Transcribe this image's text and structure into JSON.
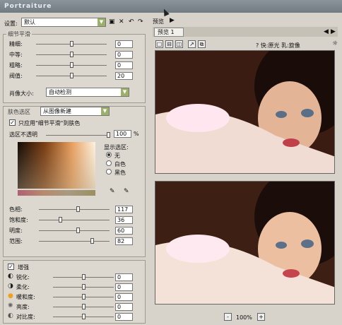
{
  "title": "Portraiture",
  "settings": {
    "label": "设置:",
    "value": "默认"
  },
  "smooth": {
    "title": "细节平滑",
    "rows": [
      {
        "label": "精细:",
        "value": "0",
        "pos": 0.5
      },
      {
        "label": "中等:",
        "value": "0",
        "pos": 0.5
      },
      {
        "label": "粗略:",
        "value": "0",
        "pos": 0.5
      },
      {
        "label": "阀值:",
        "value": "20",
        "pos": 0.5
      }
    ],
    "size_label": "肖像大小:",
    "size_value": "自动检测"
  },
  "skin": {
    "title": "肤色选区",
    "mode": "从图像新建",
    "apply_label": "只应用\"细节平滑\"到肤色",
    "opacity_label": "选区不透明",
    "opacity_value": "100",
    "percent": "%",
    "show_label": "显示选区:",
    "radio": [
      "无",
      "白色",
      "黑色"
    ],
    "params": [
      {
        "label": "色相:",
        "value": "117",
        "pos": 0.55
      },
      {
        "label": "饱和度:",
        "value": "36",
        "pos": 0.3
      },
      {
        "label": "明度:",
        "value": "60",
        "pos": 0.55
      },
      {
        "label": "范围:",
        "value": "82",
        "pos": 0.75
      }
    ]
  },
  "enhance": {
    "title": "增强",
    "rows": [
      {
        "label": "锐化:",
        "value": "0"
      },
      {
        "label": "柔化:",
        "value": "0"
      },
      {
        "label": "暖和度:",
        "value": "0"
      },
      {
        "label": "亮度:",
        "value": "0"
      },
      {
        "label": "对比度:",
        "value": "0"
      }
    ]
  },
  "preview": {
    "label": "预览",
    "tab": "预览 1",
    "info": "?  快:原光 乳:旋像",
    "zoom": "100%",
    "minus": "-",
    "plus": "+"
  },
  "colors": {
    "accent": "#9cb06a",
    "title_bg": "#7f878d"
  }
}
